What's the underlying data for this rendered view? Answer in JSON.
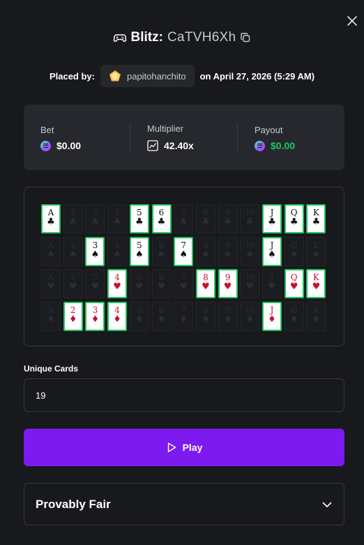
{
  "header": {
    "game_icon": "gamepad-icon",
    "game_name": "Blitz:",
    "bet_id": "CaTVH6Xh",
    "copy_icon": "copy-icon",
    "close_icon": "close-icon"
  },
  "placed": {
    "label": "Placed by:",
    "avatar_icon": "pentagon-avatar-icon",
    "username": "papitohanchito",
    "date_text": "on April 27, 2026 (5:29 AM)"
  },
  "stats": {
    "bet": {
      "label": "Bet",
      "value": "$0.00",
      "icon": "coin-icon"
    },
    "multiplier": {
      "label": "Multiplier",
      "value": "42.40x",
      "icon": "chart-icon"
    },
    "payout": {
      "label": "Payout",
      "value": "$0.00",
      "icon": "coin-icon"
    }
  },
  "cards": {
    "ranks": [
      "A",
      "2",
      "3",
      "4",
      "5",
      "6",
      "7",
      "8",
      "9",
      "10",
      "J",
      "Q",
      "K"
    ],
    "rows": [
      {
        "suit": "clubs",
        "symbol": "♣",
        "color": "black",
        "selected": [
          "A",
          "5",
          "6",
          "J",
          "Q",
          "K"
        ]
      },
      {
        "suit": "spades",
        "symbol": "♠",
        "color": "black",
        "selected": [
          "3",
          "5",
          "7",
          "J"
        ]
      },
      {
        "suit": "hearts",
        "symbol": "♥",
        "color": "red",
        "selected": [
          "4",
          "8",
          "9",
          "Q",
          "K"
        ]
      },
      {
        "suit": "diamonds",
        "symbol": "♦",
        "color": "red",
        "selected": [
          "2",
          "3",
          "4",
          "J"
        ]
      }
    ]
  },
  "unique_cards": {
    "label": "Unique Cards",
    "value": "19"
  },
  "play": {
    "label": "Play",
    "icon": "play-icon"
  },
  "provably_fair": {
    "label": "Provably Fair",
    "icon": "chevron-down-icon"
  },
  "colors": {
    "background": "#18191c",
    "panel": "#26282d",
    "accent_purple": "#7c1aef",
    "payout_green": "#22c55e",
    "card_border_green": "#22c55e",
    "red_suit": "#c8102e"
  }
}
